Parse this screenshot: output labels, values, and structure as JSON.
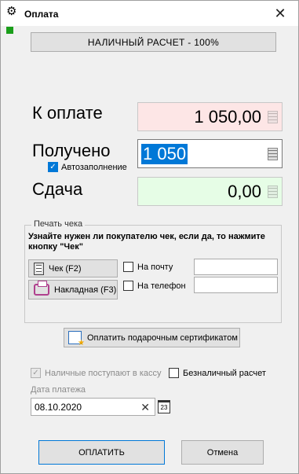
{
  "window": {
    "title": "Оплата",
    "app_icon": "gear-icon",
    "close_icon": "close-icon"
  },
  "mode_button": {
    "label": "НАЛИЧНЫЙ РАСЧЕТ - 100%"
  },
  "to_pay": {
    "label": "К оплате",
    "value": "1 050,00",
    "icon": "calculator-icon"
  },
  "received": {
    "label": "Получено",
    "value": "1 050",
    "icon": "calculator-icon"
  },
  "autofill": {
    "label": "Автозаполнение",
    "checked": true
  },
  "change": {
    "label": "Сдача",
    "value": "0,00",
    "icon": "calculator-icon"
  },
  "receipt_group": {
    "title": "Печать чека",
    "description": "Узнайте нужен ли покупателю чек, если да, то нажмите кнопку \"Чек\"",
    "receipt_button": "Чек (F2)",
    "invoice_button": "Накладная (F3)",
    "email_label": "На почту",
    "email_value": "",
    "phone_label": "На телефон",
    "phone_value": ""
  },
  "gift_button": {
    "label": "Оплатить подарочным сертификатом"
  },
  "cash_register": {
    "label": "Наличные поступают в кассу",
    "checked": true,
    "disabled": true
  },
  "cashless": {
    "label": "Безналичный расчет",
    "checked": false
  },
  "payment_date": {
    "label": "Дата платежа",
    "value": "08.10.2020",
    "calendar_day": "23"
  },
  "footer": {
    "ok_label": "ОПЛАТИТЬ",
    "cancel_label": "Отмена"
  }
}
